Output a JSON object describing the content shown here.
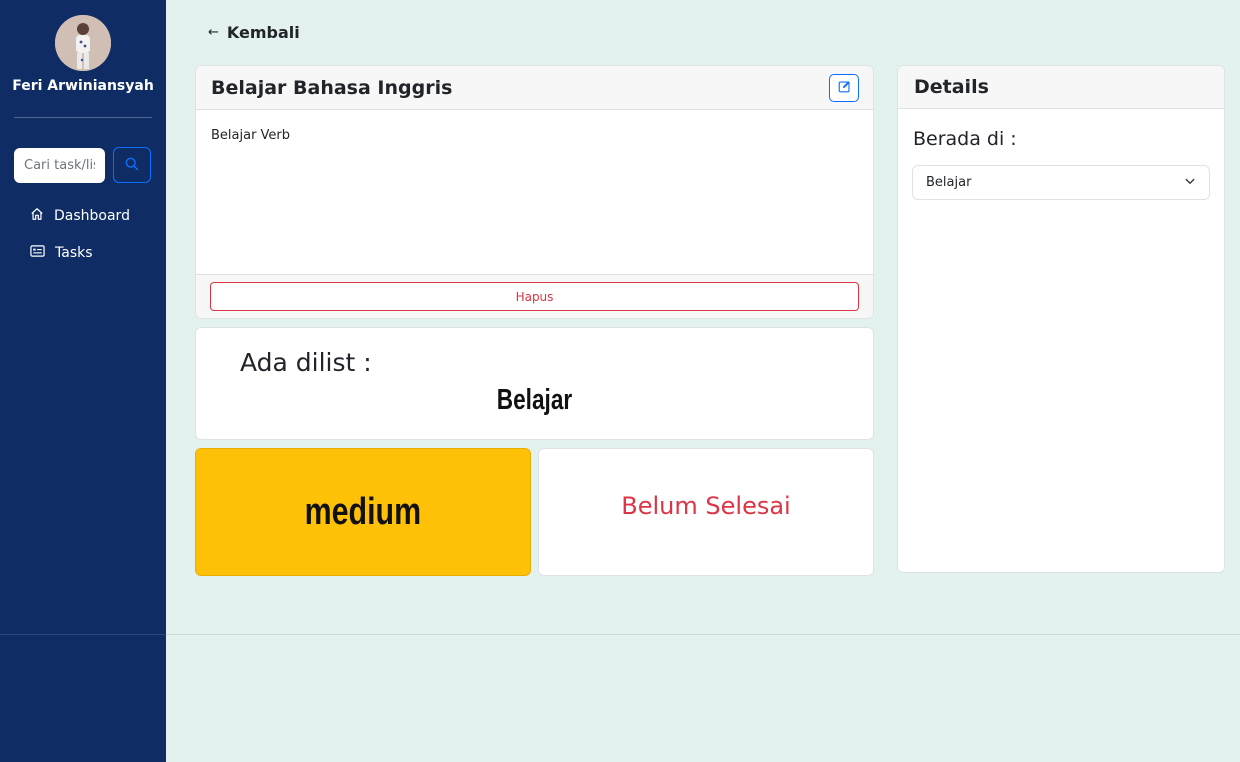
{
  "colors": {
    "sidebar_bg": "#0f2d64",
    "page_bg": "#e3f2ef",
    "primary": "#0d6efd",
    "danger": "#dc3545",
    "warning": "#ffc107"
  },
  "sidebar": {
    "username": "Feri Arwiniansyah",
    "search": {
      "placeholder": "Cari task/list",
      "value": ""
    },
    "nav": [
      {
        "label": "Dashboard",
        "icon": "home-icon"
      },
      {
        "label": "Tasks",
        "icon": "tasks-icon"
      }
    ]
  },
  "main": {
    "back_label": "Kembali",
    "task": {
      "title": "Belajar Bahasa Inggris",
      "description": "Belajar Verb",
      "delete_label": "Hapus"
    },
    "list_info": {
      "label": "Ada dilist :",
      "value": "Belajar"
    },
    "priority": "medium",
    "status": "Belum Selesai"
  },
  "details": {
    "title": "Details",
    "located_label": "Berada di :",
    "selected_list": "Belajar"
  }
}
